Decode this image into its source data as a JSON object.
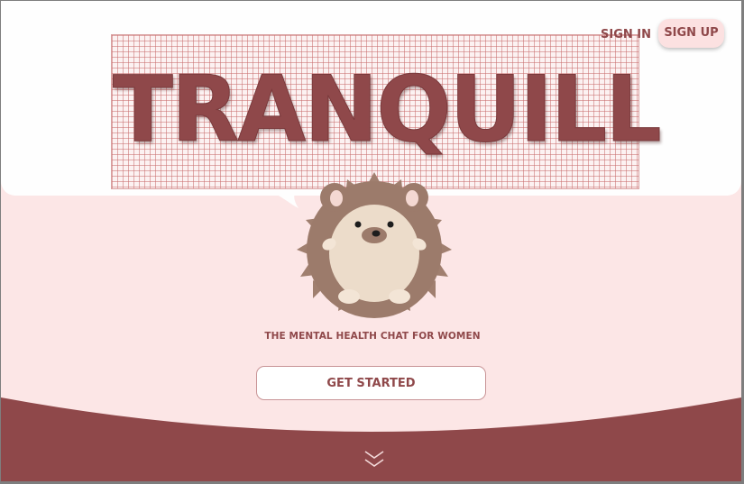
{
  "app": {
    "logo_text": "TRANQUILL",
    "tagline": "THE MENTAL HEALTH CHAT FOR WOMEN"
  },
  "nav": {
    "sign_in_label": "SIGN IN",
    "sign_up_label": "SIGN UP"
  },
  "hero": {
    "cta_label": "GET STARTED",
    "scroll_icon": "double-chevron-down-icon",
    "mascot_icon": "hedgehog-icon"
  },
  "colors": {
    "brand": "#8f484a",
    "background": "#fce6e6",
    "surface": "#fefefe",
    "accent_pill": "#fce1e1"
  }
}
